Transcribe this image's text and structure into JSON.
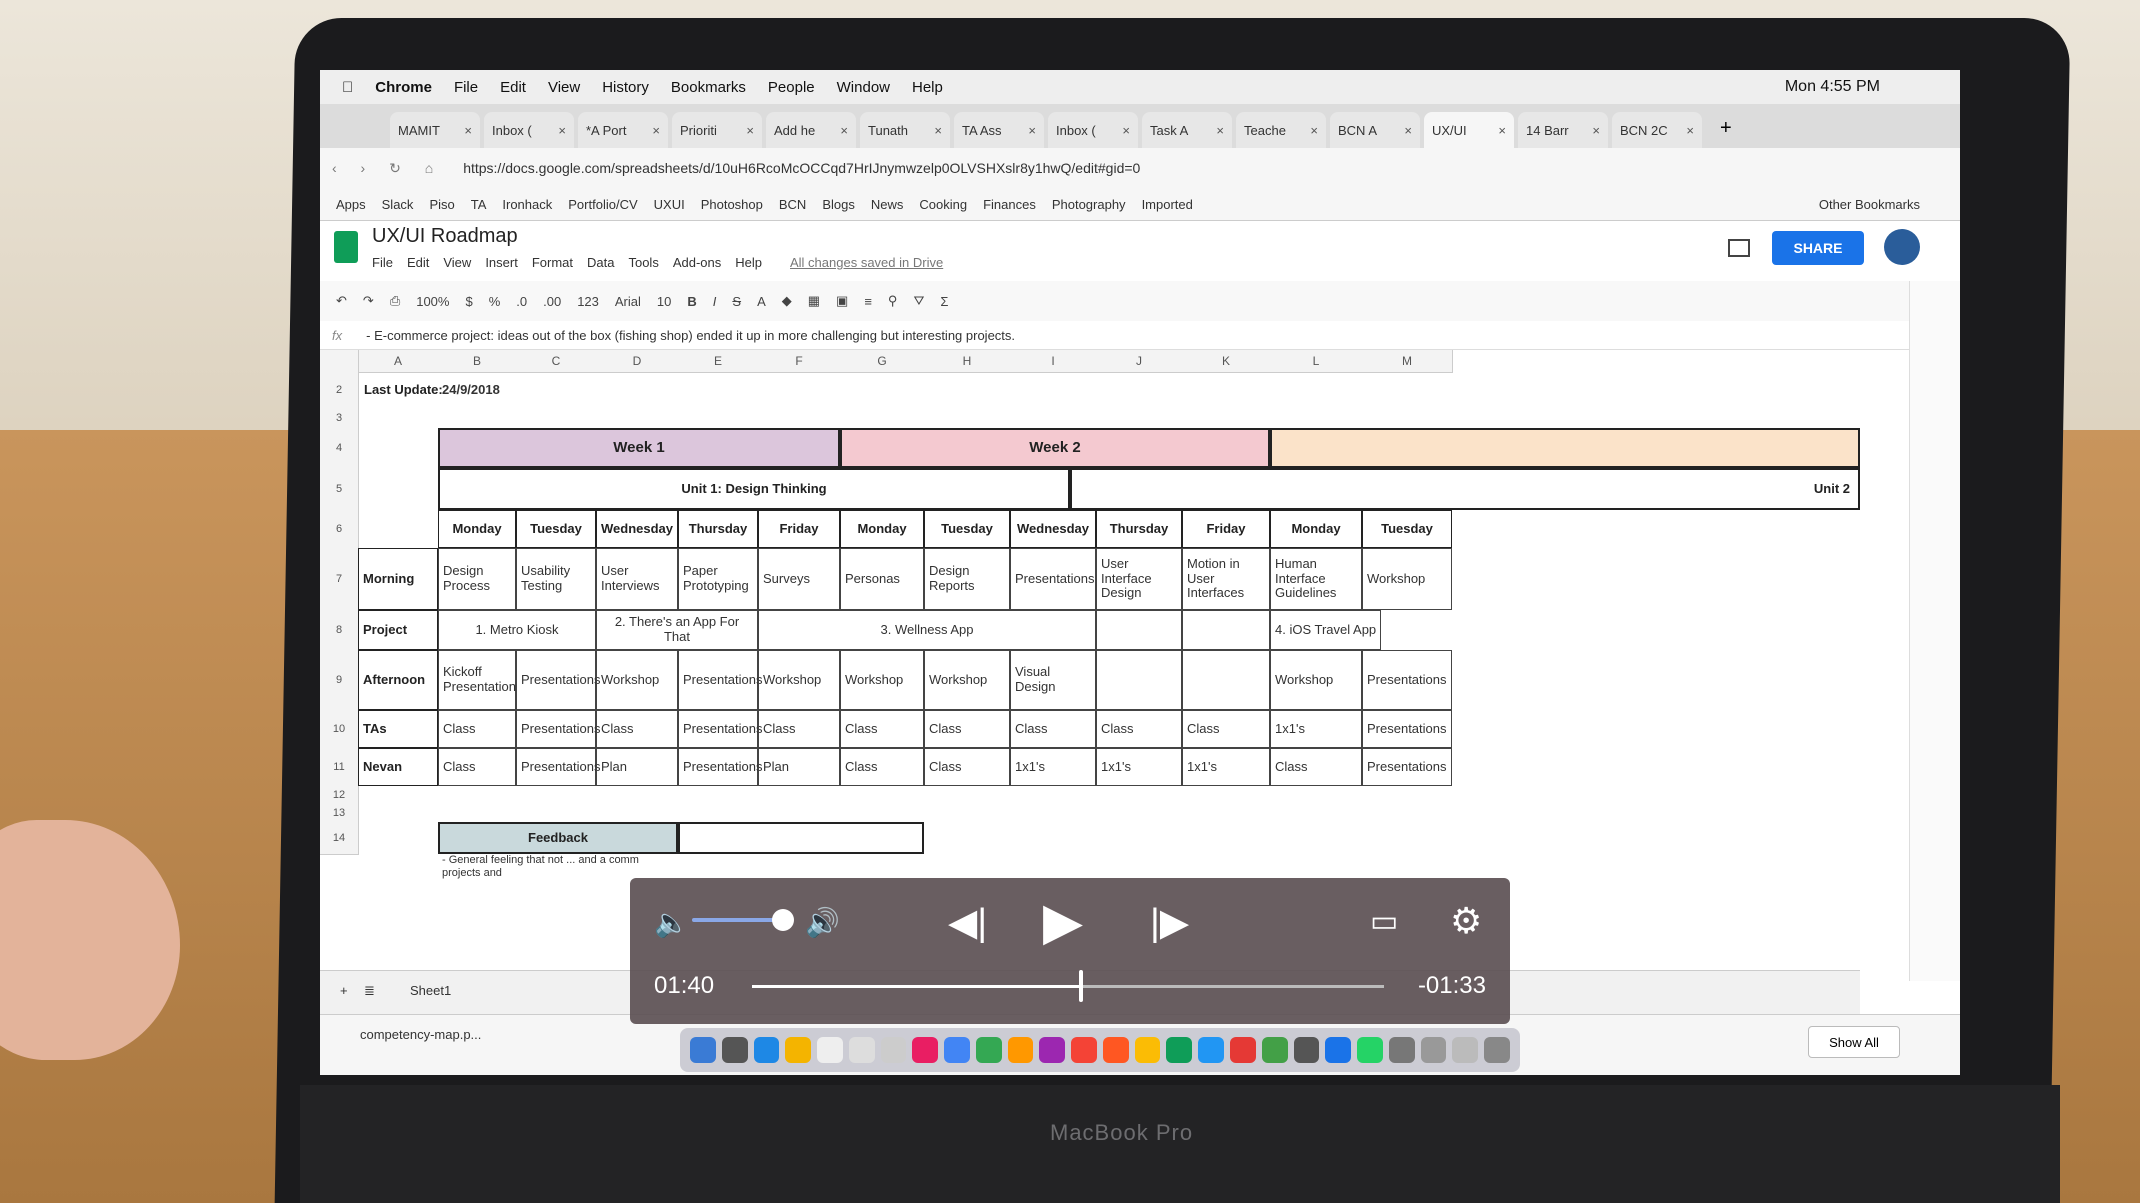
{
  "macos": {
    "menubar": [
      "Chrome",
      "File",
      "Edit",
      "View",
      "History",
      "Bookmarks",
      "People",
      "Window",
      "Help"
    ],
    "clock": "Mon 4:55 PM"
  },
  "browser": {
    "tabs": [
      "MAMIT",
      "Inbox (",
      "*A Port",
      "Prioriti",
      "Add he",
      "Tunath",
      "TA Ass",
      "Inbox (",
      "Task A",
      "Teache",
      "BCN A",
      "UX/UI",
      "14 Barr",
      "BCN 2C"
    ],
    "active_tab_index": 11,
    "url": "https://docs.google.com/spreadsheets/d/10uH6RcoMcOCCqd7HrIJnymwzelp0OLVSHXslr8y1hwQ/edit#gid=0",
    "bookmarks": [
      "Apps",
      "Slack",
      "Piso",
      "TA",
      "Ironhack",
      "Portfolio/CV",
      "UXUI",
      "Photoshop",
      "BCN",
      "Blogs",
      "News",
      "Cooking",
      "Finances",
      "Photography",
      "Imported"
    ],
    "other_bookmarks": "Other Bookmarks"
  },
  "sheets": {
    "title": "UX/UI Roadmap",
    "menu": [
      "File",
      "Edit",
      "View",
      "Insert",
      "Format",
      "Data",
      "Tools",
      "Add-ons",
      "Help"
    ],
    "saved_status": "All changes saved in Drive",
    "share_label": "SHARE",
    "toolbar": {
      "zoom": "100%",
      "currency": "$",
      "percent": "%",
      "dec_less": ".0",
      "dec_more": ".00",
      "format": "123",
      "font": "Arial",
      "size": "10",
      "bold": "B",
      "italic": "I",
      "strike": "S",
      "sigma": "Σ"
    },
    "formula_bar": "- E-commerce project: ideas out of the box (fishing shop) ended it up in more challenging but interesting projects.",
    "columns": [
      "A",
      "B",
      "C",
      "D",
      "E",
      "F",
      "G",
      "H",
      "I",
      "J",
      "K",
      "L",
      "M"
    ],
    "rows": [
      "2",
      "3",
      "4",
      "5",
      "6",
      "7",
      "8",
      "9",
      "10",
      "11",
      "12",
      "13",
      "14"
    ],
    "last_update_label": "Last Update:",
    "last_update_value": "24/9/2018",
    "week1": "Week 1",
    "week2": "Week 2",
    "unit1": "Unit 1: Design Thinking",
    "unit2": "Unit 2",
    "days": [
      "Monday",
      "Tuesday",
      "Wednesday",
      "Thursday",
      "Friday",
      "Monday",
      "Tuesday",
      "Wednesday",
      "Thursday",
      "Friday",
      "Monday",
      "Tuesday"
    ],
    "row_labels": [
      "Morning",
      "Project",
      "Afternoon",
      "TAs",
      "Nevan"
    ],
    "morning": [
      "Design Process",
      "Usability Testing",
      "User Interviews",
      "Paper Prototyping",
      "Surveys",
      "Personas",
      "Design Reports",
      "Presentations",
      "User Interface Design",
      "Motion in User Interfaces",
      "Human Interface Guidelines",
      "Workshop"
    ],
    "projects": [
      "1. Metro Kiosk",
      "2. There's an App For That",
      "3. Wellness App",
      "4. iOS Travel App"
    ],
    "afternoon": [
      "Kickoff Presentation",
      "Presentations",
      "Workshop",
      "Presentations",
      "Workshop",
      "Workshop",
      "Workshop",
      "Visual Design",
      "",
      "",
      "Workshop",
      "Presentations"
    ],
    "tas": [
      "Class",
      "Presentations",
      "Class",
      "Presentations",
      "Class",
      "Class",
      "Class",
      "Class",
      "Class",
      "Class",
      "1x1's",
      "Presentations"
    ],
    "nevan": [
      "Class",
      "Presentations",
      "Plan",
      "Presentations",
      "Plan",
      "Class",
      "Class",
      "1x1's",
      "1x1's",
      "1x1's",
      "Class",
      "Presentations"
    ],
    "feedback_header": "Feedback",
    "feedback_text": "- General feeling that not ... and a comm projects and",
    "sheet_tab": "Sheet1",
    "download_file": "competency-map.p...",
    "show_all": "Show All"
  },
  "player": {
    "current_time": "01:40",
    "remaining_time": "-01:33",
    "progress": 0.52,
    "volume": 0.85
  },
  "laptop_label": "MacBook Pro",
  "colors": {
    "week1_fill": "#dcc6dc",
    "week2_fill": "#f4c9d0",
    "unit2_fill": "#fbe3c9",
    "share_blue": "#1a73e8",
    "sheets_green": "#0f9d58"
  }
}
